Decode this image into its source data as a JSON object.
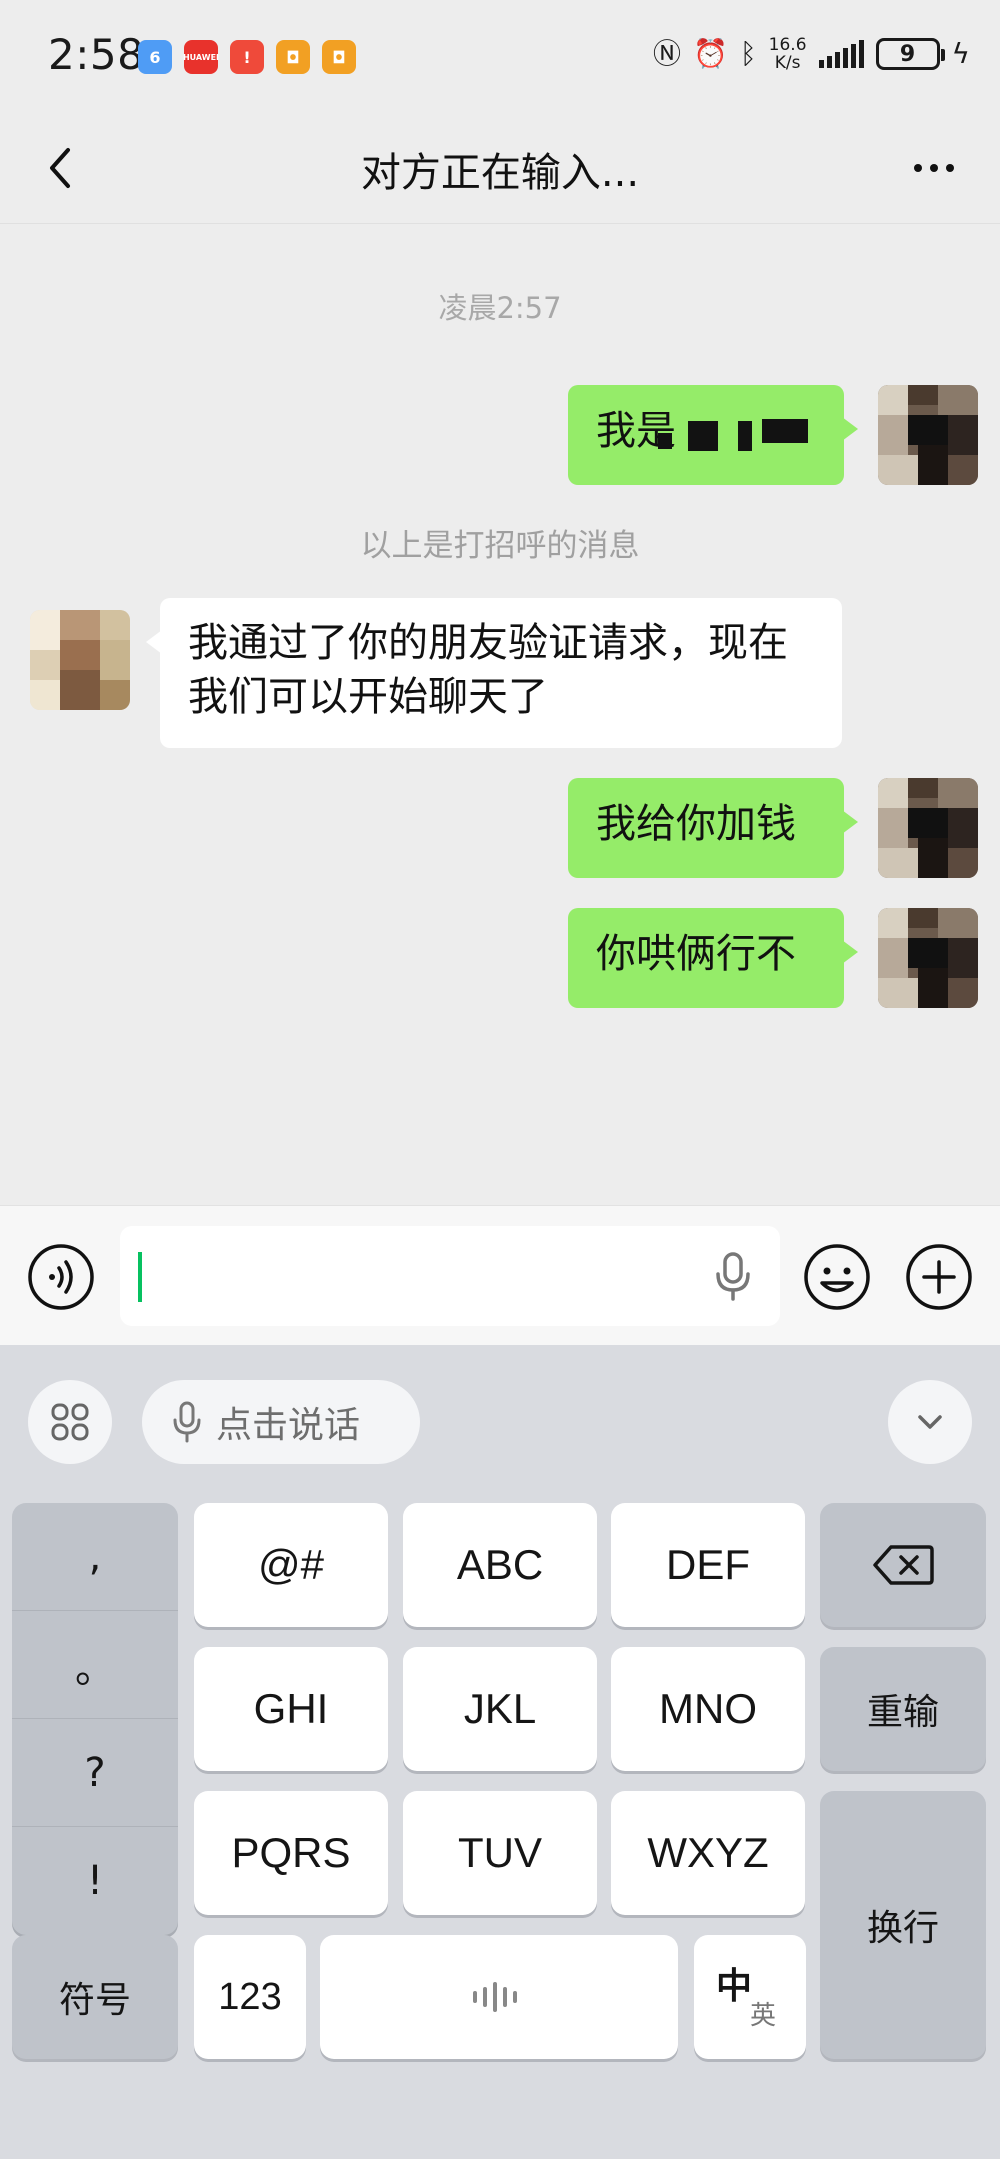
{
  "status_bar": {
    "time": "2:58",
    "net_speed_value": "16.6",
    "net_speed_unit": "K/s",
    "battery": "9"
  },
  "header": {
    "title": "对方正在输入..."
  },
  "messages": {
    "time_divider": "凌晨2:57",
    "greeting_prefix": "我是",
    "system_note": "以上是打招呼的消息",
    "verify_text": "我通过了你的朋友验证请求，现在我们可以开始聊天了",
    "msg_add_money": "我给你加钱",
    "msg_coax": "你哄俩行不"
  },
  "keyboard": {
    "voice_label": "点击说话",
    "punct": [
      ",",
      "。",
      "?",
      "!"
    ],
    "key_symbols": "@#",
    "key_abc": "ABC",
    "key_def": "DEF",
    "key_ghi": "GHI",
    "key_jkl": "JKL",
    "key_mno": "MNO",
    "key_pqrs": "PQRS",
    "key_tuv": "TUV",
    "key_wxyz": "WXYZ",
    "key_retype": "重输",
    "key_newline": "换行",
    "key_symbol_panel": "符号",
    "key_123": "123",
    "lang_zh": "中",
    "lang_en": "英"
  },
  "colors": {
    "self_bubble": "#95ec69",
    "other_bubble": "#ffffff",
    "caret": "#07c160"
  }
}
